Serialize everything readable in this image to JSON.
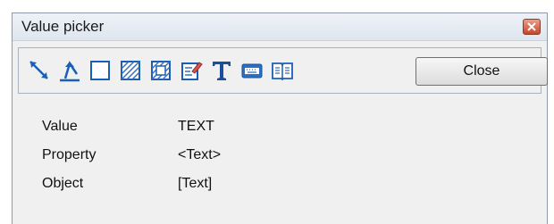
{
  "window": {
    "title": "Value picker",
    "close_button_label": "Close"
  },
  "toolbar": {
    "tools": [
      {
        "icon": "line-arrow-icon"
      },
      {
        "icon": "polyline-arrow-icon"
      },
      {
        "icon": "rectangle-icon"
      },
      {
        "icon": "hatched-rectangle-icon"
      },
      {
        "icon": "hatched-frame-icon"
      },
      {
        "icon": "edit-document-icon"
      },
      {
        "icon": "text-icon"
      },
      {
        "icon": "keyboard-icon"
      },
      {
        "icon": "book-icon"
      }
    ]
  },
  "properties": [
    {
      "label": "Value",
      "value": "TEXT"
    },
    {
      "label": "Property",
      "value": "<Text>"
    },
    {
      "label": "Object",
      "value": "[Text]"
    }
  ],
  "colors": {
    "titlebar_close": "#c7442a",
    "accent_blue": "#1b5fb5"
  }
}
